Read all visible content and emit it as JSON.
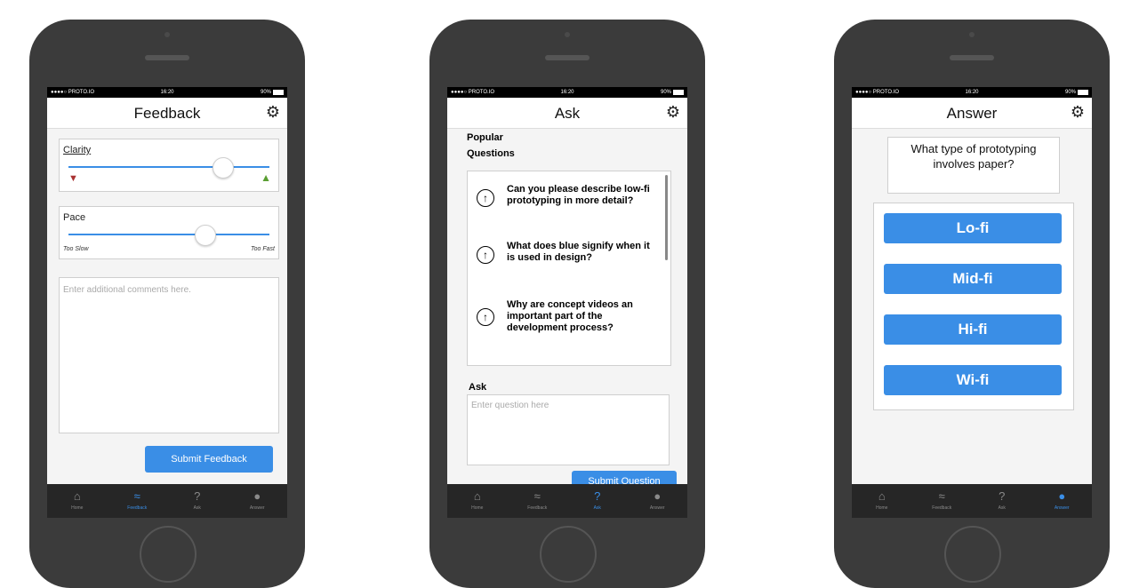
{
  "statusbar": {
    "carrier": "●●●●○ PROTO.IO",
    "time": "16:20",
    "battery": "90%"
  },
  "tabs": [
    {
      "label": "Home",
      "icon": "home-icon"
    },
    {
      "label": "Feedback",
      "icon": "chart-icon"
    },
    {
      "label": "Ask",
      "icon": "question-icon"
    },
    {
      "label": "Answer",
      "icon": "speech-bubble-icon"
    }
  ],
  "feedback": {
    "title": "Feedback",
    "clarity_label": "Clarity",
    "clarity_level": 0.77,
    "pace_label": "Pace",
    "pace_level": 0.68,
    "pace_min": "Too Slow",
    "pace_max": "Too Fast",
    "comments_placeholder": "Enter additional comments here.",
    "submit_label": "Submit Feedback",
    "active_tab": "Feedback"
  },
  "ask": {
    "title": "Ask",
    "popular_label": "Popular Questions",
    "questions": [
      "Can you please describe low-fi prototyping in more detail?",
      "What does blue signify when it is used in design?",
      "Why are concept videos an important part of the development process?"
    ],
    "ask_label": "Ask",
    "question_placeholder": "Enter question here",
    "submit_label": "Submit Question",
    "active_tab": "Ask"
  },
  "answer": {
    "title": "Answer",
    "question": "What type of prototyping involves paper?",
    "options": [
      "Lo-fi",
      "Mid-fi",
      "Hi-fi",
      "Wi-fi"
    ],
    "active_tab": "Answer"
  },
  "colors": {
    "accent": "#3a8ee6",
    "phone_body": "#3b3b3b",
    "tabbar": "#262626",
    "screen_bg": "#f4f4f4"
  }
}
